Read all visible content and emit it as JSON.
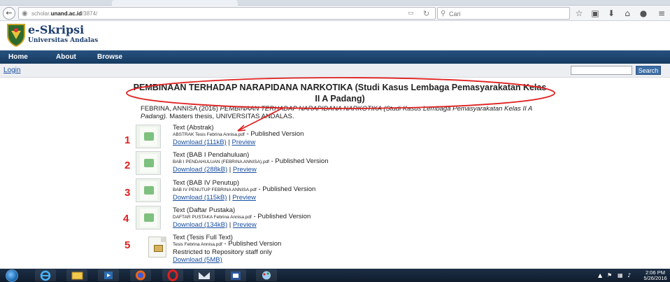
{
  "browser": {
    "url_host_prefix": "scholar.",
    "url_host_bold": "unand.ac.id",
    "url_path": "/3874/",
    "search_placeholder": "Cari",
    "icons": [
      "back-icon",
      "globe-icon",
      "reader-icon",
      "reload-icon",
      "search-icon",
      "star-icon",
      "clipboard-icon",
      "download-icon",
      "home-icon",
      "chat-icon",
      "menu-icon"
    ]
  },
  "site": {
    "logo_title": "e-Skripsi",
    "logo_subtitle": "Universitas Andalas",
    "nav": {
      "home": "Home",
      "about": "About",
      "browse": "Browse"
    },
    "login": "Login",
    "search_button": "Search"
  },
  "record": {
    "title": "PEMBINAAN TERHADAP NARAPIDANA NARKOTIKA (Studi Kasus Lembaga Pemasyarakatan Kelas II A Padang)",
    "citation_pre": "FEBRINA, ANNISA (2016) ",
    "citation_title": "PEMBINAAN TERHADAP NARAPIDANA NARKOTIKA (Studi Kasus Lembaga Pemasyarakatan Kelas II A Padang).",
    "citation_post": " Masters thesis, UNIVERSITAS ANDALAS.",
    "documents": [
      {
        "number": "1",
        "title": "Text (Abstrak)",
        "file": "ABSTRAK Tesis Febrina Annisa.pdf",
        "version": " - Published Version",
        "download": "Download (111kB)",
        "preview": "Preview"
      },
      {
        "number": "2",
        "title": "Text (BAB I Pendahuluan)",
        "file": "BAB I PENDAHULUAN (FEBRINA ANNISA).pdf",
        "version": " - Published Version",
        "download": "Download (288kB)",
        "preview": "Preview"
      },
      {
        "number": "3",
        "title": "Text (BAB IV Penutup)",
        "file": "BAB IV PENUTUP FEBRINA ANNISA.pdf",
        "version": " - Published Version",
        "download": "Download (115kB)",
        "preview": "Preview"
      },
      {
        "number": "4",
        "title": "Text (Daftar Pustaka)",
        "file": "DAFTAR PUSTAKA Febrina Annisa.pdf",
        "version": " - Published Version",
        "download": "Download (134kB)",
        "preview": "Preview"
      },
      {
        "number": "5",
        "title": "Text (Tesis Full Text)",
        "file": "Tesis Febrina Annisa.pdf",
        "version": " - Published Version",
        "restricted": "Restricted to Repository staff only",
        "download": "Download (5MB)"
      }
    ],
    "separator": " | "
  },
  "annotation": {
    "color": "#e02020"
  },
  "taskbar": {
    "time": "2:06 PM",
    "date": "5/26/2016",
    "apps": [
      "windows-start-icon",
      "internet-explorer-icon",
      "file-explorer-icon",
      "media-player-icon",
      "firefox-icon",
      "opera-icon",
      "mail-icon",
      "word-icon",
      "paint-icon"
    ]
  }
}
